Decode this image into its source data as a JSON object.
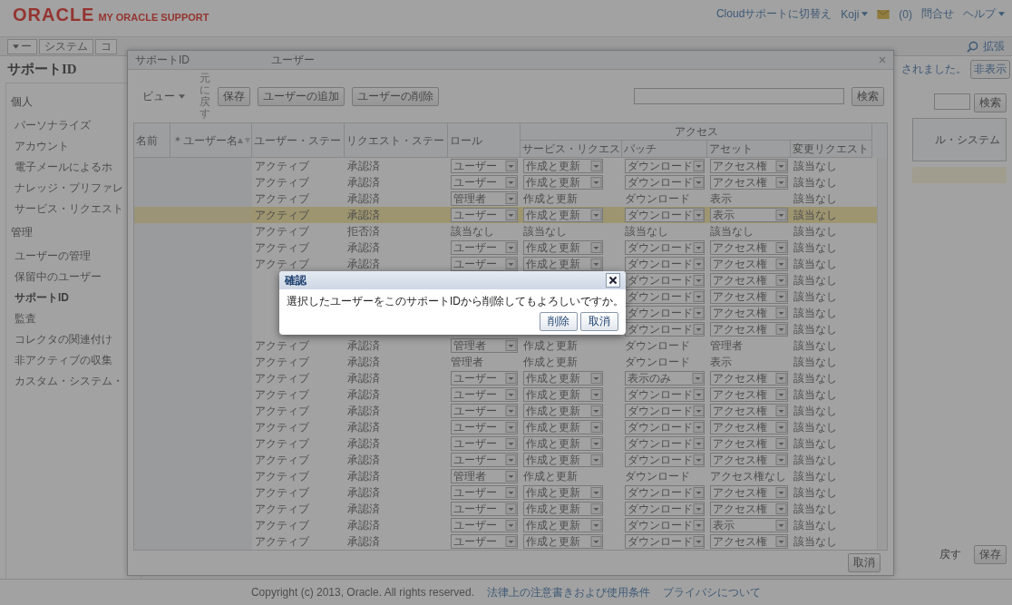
{
  "header": {
    "logo": "ORACLE",
    "product": "MY ORACLE SUPPORT",
    "links": [
      {
        "label": "Cloudサポートに切替え",
        "menu": false
      },
      {
        "label": "Koji",
        "menu": true
      }
    ],
    "mail_count": "(0)",
    "contact": "問合せ",
    "help": {
      "label": "ヘルプ",
      "menu": true
    }
  },
  "nav": {
    "tabs": [
      {
        "label": "ー",
        "menu": true
      },
      {
        "label": "システム",
        "menu": false
      },
      {
        "label": "コ",
        "menu": false
      }
    ],
    "advanced": "拡張"
  },
  "page": {
    "title": "サポートID",
    "notice": "されました。",
    "hide_link": "非表示"
  },
  "sidebar": {
    "sections": [
      {
        "title": "個人",
        "items": [
          {
            "label": "パーソナライズ",
            "selected": false
          },
          {
            "label": "アカウント",
            "selected": false
          },
          {
            "label": "電子メールによるホ",
            "selected": false
          },
          {
            "label": "ナレッジ・プリファレ",
            "selected": false
          },
          {
            "label": "サービス・リクエスト",
            "selected": false
          }
        ]
      },
      {
        "title": "管理",
        "items": [
          {
            "label": "ユーザーの管理",
            "selected": false
          },
          {
            "label": "保留中のユーザー",
            "selected": false
          },
          {
            "label": "サポートID",
            "selected": true
          },
          {
            "label": "監査",
            "selected": false
          },
          {
            "label": "コレクタの関連付け",
            "selected": false
          },
          {
            "label": "非アクティブの収集",
            "selected": false
          },
          {
            "label": "カスタム・システム・",
            "selected": false
          }
        ]
      }
    ]
  },
  "right_panel": {
    "search_button": "検索",
    "item": "ル・システム",
    "undo": "戻す",
    "save": "保存"
  },
  "popup": {
    "title": "サポートID",
    "subtitle": "ユーザー",
    "view": "ビュー",
    "undo": "元に戻す",
    "buttons": [
      "保存",
      "ユーザーの追加",
      "ユーザーの削除"
    ],
    "search_button": "検索",
    "cancel": "取消",
    "table": {
      "columns": [
        "名前",
        "＊ユーザー名",
        "ユーザー・ステー",
        "リクエスト・ステー",
        "ロール"
      ],
      "group": "アクセス",
      "group_columns": [
        "サービス・リクエス",
        "パッチ",
        "アセット",
        "変更リクエスト"
      ],
      "rows": [
        {
          "status": "アクティブ",
          "request": "承認済",
          "role": {
            "value": "ユーザー",
            "dropdown": true
          },
          "service_request": {
            "value": "作成と更新",
            "dropdown": true
          },
          "patch": {
            "value": "ダウンロード",
            "dropdown": true
          },
          "asset": {
            "value": "アクセス権",
            "dropdown": true
          },
          "change": "該当なし",
          "highlighted": false
        },
        {
          "status": "アクティブ",
          "request": "承認済",
          "role": {
            "value": "ユーザー",
            "dropdown": true
          },
          "service_request": {
            "value": "作成と更新",
            "dropdown": true
          },
          "patch": {
            "value": "ダウンロード",
            "dropdown": true
          },
          "asset": {
            "value": "アクセス権",
            "dropdown": true
          },
          "change": "該当なし",
          "highlighted": false
        },
        {
          "status": "アクティブ",
          "request": "承認済",
          "role": {
            "value": "管理者",
            "dropdown": true
          },
          "service_request": {
            "value": "作成と更新",
            "dropdown": false
          },
          "patch": {
            "value": "ダウンロード",
            "dropdown": false
          },
          "asset": {
            "value": "表示",
            "dropdown": false
          },
          "change": "該当なし",
          "highlighted": false
        },
        {
          "status": "アクティブ",
          "request": "承認済",
          "role": {
            "value": "ユーザー",
            "dropdown": true
          },
          "service_request": {
            "value": "作成と更新",
            "dropdown": true
          },
          "patch": {
            "value": "ダウンロード",
            "dropdown": true
          },
          "asset": {
            "value": "表示",
            "dropdown": true
          },
          "change": "該当なし",
          "highlighted": true
        },
        {
          "status": "アクティブ",
          "request": "拒否済",
          "role": {
            "value": "該当なし",
            "dropdown": false
          },
          "service_request": {
            "value": "該当なし",
            "dropdown": false
          },
          "patch": {
            "value": "該当なし",
            "dropdown": false
          },
          "asset": {
            "value": "該当なし",
            "dropdown": false
          },
          "change": "該当なし",
          "highlighted": false
        },
        {
          "status": "アクティブ",
          "request": "承認済",
          "role": {
            "value": "ユーザー",
            "dropdown": true
          },
          "service_request": {
            "value": "作成と更新",
            "dropdown": true
          },
          "patch": {
            "value": "ダウンロード",
            "dropdown": true
          },
          "asset": {
            "value": "アクセス権",
            "dropdown": true
          },
          "change": "該当なし",
          "highlighted": false
        },
        {
          "status": "アクティブ",
          "request": "承認済",
          "role": {
            "value": "ユーザー",
            "dropdown": true
          },
          "service_request": {
            "value": "作成と更新",
            "dropdown": true
          },
          "patch": {
            "value": "ダウンロード",
            "dropdown": true
          },
          "asset": {
            "value": "アクセス権",
            "dropdown": true
          },
          "change": "該当なし",
          "highlighted": false
        },
        {
          "patch": {
            "value": "ダウンロード",
            "dropdown": true
          },
          "asset": {
            "value": "アクセス権",
            "dropdown": true
          },
          "change": "該当なし",
          "highlighted": false
        },
        {
          "patch": {
            "value": "ダウンロード",
            "dropdown": true
          },
          "asset": {
            "value": "アクセス権",
            "dropdown": true
          },
          "change": "該当なし",
          "highlighted": false
        },
        {
          "patch": {
            "value": "ダウンロード",
            "dropdown": true
          },
          "asset": {
            "value": "アクセス権",
            "dropdown": true
          },
          "change": "該当なし",
          "highlighted": false
        },
        {
          "patch": {
            "value": "ダウンロード",
            "dropdown": true
          },
          "asset": {
            "value": "アクセス権",
            "dropdown": true
          },
          "change": "該当なし",
          "highlighted": false
        },
        {
          "status": "アクティブ",
          "request": "承認済",
          "role": {
            "value": "管理者",
            "dropdown": true
          },
          "service_request": {
            "value": "作成と更新",
            "dropdown": false
          },
          "patch": {
            "value": "ダウンロード",
            "dropdown": false
          },
          "asset": {
            "value": "管理者",
            "dropdown": false
          },
          "change": "該当なし",
          "highlighted": false
        },
        {
          "status": "アクティブ",
          "request": "承認済",
          "role": {
            "value": "管理者",
            "dropdown": false
          },
          "service_request": {
            "value": "作成と更新",
            "dropdown": false
          },
          "patch": {
            "value": "ダウンロード",
            "dropdown": false
          },
          "asset": {
            "value": "表示",
            "dropdown": false
          },
          "change": "該当なし",
          "highlighted": false
        },
        {
          "status": "アクティブ",
          "request": "承認済",
          "role": {
            "value": "ユーザー",
            "dropdown": true
          },
          "service_request": {
            "value": "作成と更新",
            "dropdown": true
          },
          "patch": {
            "value": "表示のみ",
            "dropdown": true
          },
          "asset": {
            "value": "アクセス権",
            "dropdown": true
          },
          "change": "該当なし",
          "highlighted": false
        },
        {
          "status": "アクティブ",
          "request": "承認済",
          "role": {
            "value": "ユーザー",
            "dropdown": true
          },
          "service_request": {
            "value": "作成と更新",
            "dropdown": true
          },
          "patch": {
            "value": "ダウンロード",
            "dropdown": true
          },
          "asset": {
            "value": "アクセス権",
            "dropdown": true
          },
          "change": "該当なし",
          "highlighted": false
        },
        {
          "status": "アクティブ",
          "request": "承認済",
          "role": {
            "value": "ユーザー",
            "dropdown": true
          },
          "service_request": {
            "value": "作成と更新",
            "dropdown": true
          },
          "patch": {
            "value": "ダウンロード",
            "dropdown": true
          },
          "asset": {
            "value": "アクセス権",
            "dropdown": true
          },
          "change": "該当なし",
          "highlighted": false
        },
        {
          "status": "アクティブ",
          "request": "承認済",
          "role": {
            "value": "ユーザー",
            "dropdown": true
          },
          "service_request": {
            "value": "作成と更新",
            "dropdown": true
          },
          "patch": {
            "value": "ダウンロード",
            "dropdown": true
          },
          "asset": {
            "value": "アクセス権",
            "dropdown": true
          },
          "change": "該当なし",
          "highlighted": false
        },
        {
          "status": "アクティブ",
          "request": "承認済",
          "role": {
            "value": "ユーザー",
            "dropdown": true
          },
          "service_request": {
            "value": "作成と更新",
            "dropdown": true
          },
          "patch": {
            "value": "ダウンロード",
            "dropdown": true
          },
          "asset": {
            "value": "アクセス権",
            "dropdown": true
          },
          "change": "該当なし",
          "highlighted": false
        },
        {
          "status": "アクティブ",
          "request": "承認済",
          "role": {
            "value": "ユーザー",
            "dropdown": true
          },
          "service_request": {
            "value": "作成と更新",
            "dropdown": true
          },
          "patch": {
            "value": "ダウンロード",
            "dropdown": true
          },
          "asset": {
            "value": "アクセス権",
            "dropdown": true
          },
          "change": "該当なし",
          "highlighted": false
        },
        {
          "status": "アクティブ",
          "request": "承認済",
          "role": {
            "value": "管理者",
            "dropdown": true
          },
          "service_request": {
            "value": "作成と更新",
            "dropdown": false
          },
          "patch": {
            "value": "ダウンロード",
            "dropdown": false
          },
          "asset": {
            "value": "アクセス権なし",
            "dropdown": false
          },
          "change": "該当なし",
          "highlighted": false
        },
        {
          "status": "アクティブ",
          "request": "承認済",
          "role": {
            "value": "ユーザー",
            "dropdown": true
          },
          "service_request": {
            "value": "作成と更新",
            "dropdown": true
          },
          "patch": {
            "value": "ダウンロード",
            "dropdown": true
          },
          "asset": {
            "value": "アクセス権",
            "dropdown": true
          },
          "change": "該当なし",
          "highlighted": false
        },
        {
          "status": "アクティブ",
          "request": "承認済",
          "role": {
            "value": "ユーザー",
            "dropdown": true
          },
          "service_request": {
            "value": "作成と更新",
            "dropdown": true
          },
          "patch": {
            "value": "ダウンロード",
            "dropdown": true
          },
          "asset": {
            "value": "アクセス権",
            "dropdown": true
          },
          "change": "該当なし",
          "highlighted": false
        },
        {
          "status": "アクティブ",
          "request": "承認済",
          "role": {
            "value": "ユーザー",
            "dropdown": true
          },
          "service_request": {
            "value": "作成と更新",
            "dropdown": true
          },
          "patch": {
            "value": "ダウンロード",
            "dropdown": true
          },
          "asset": {
            "value": "表示",
            "dropdown": true
          },
          "change": "該当なし",
          "highlighted": false
        },
        {
          "status": "アクティブ",
          "request": "承認済",
          "role": {
            "value": "ユーザー",
            "dropdown": true
          },
          "service_request": {
            "value": "作成と更新",
            "dropdown": true
          },
          "patch": {
            "value": "ダウンロード",
            "dropdown": true
          },
          "asset": {
            "value": "アクセス権",
            "dropdown": true
          },
          "change": "該当なし",
          "highlighted": false
        }
      ]
    }
  },
  "footer": {
    "copyright": "Copyright (c) 2013, Oracle. All rights reserved.",
    "links": [
      "法律上の注意書きおよび使用条件",
      "プライバシについて"
    ]
  },
  "dialog": {
    "title": "確認",
    "message": "選択したユーザーをこのサポートIDから削除してもよろしいですか。",
    "buttons": [
      "削除",
      "取消"
    ]
  }
}
